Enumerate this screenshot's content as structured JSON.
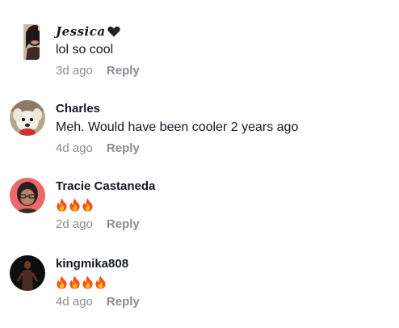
{
  "comments": [
    {
      "username": "Jessica",
      "username_suffix_icon": "black-heart-icon",
      "text": "lol so cool",
      "time": "3d ago",
      "reply_label": "Reply",
      "avatar": "avatar-jessica"
    },
    {
      "username": "Charles",
      "text": "Meh. Would have been cooler 2 years ago",
      "time": "4d ago",
      "reply_label": "Reply",
      "avatar": "avatar-dog"
    },
    {
      "username": "Tracie Castaneda",
      "text": "🔥🔥🔥",
      "emoji_icon": "fire-icon",
      "emoji_count": 3,
      "time": "2d ago",
      "reply_label": "Reply",
      "avatar": "avatar-tracie"
    },
    {
      "username": "kingmika808",
      "text": "🔥🔥🔥🔥",
      "emoji_icon": "fire-icon",
      "emoji_count": 4,
      "time": "4d ago",
      "reply_label": "Reply",
      "avatar": "avatar-dark"
    }
  ],
  "colors": {
    "text": "#161823",
    "muted": "#8a8b91",
    "background": "#ffffff",
    "flame_outer": "#f4511e",
    "flame_inner": "#ffc107"
  }
}
